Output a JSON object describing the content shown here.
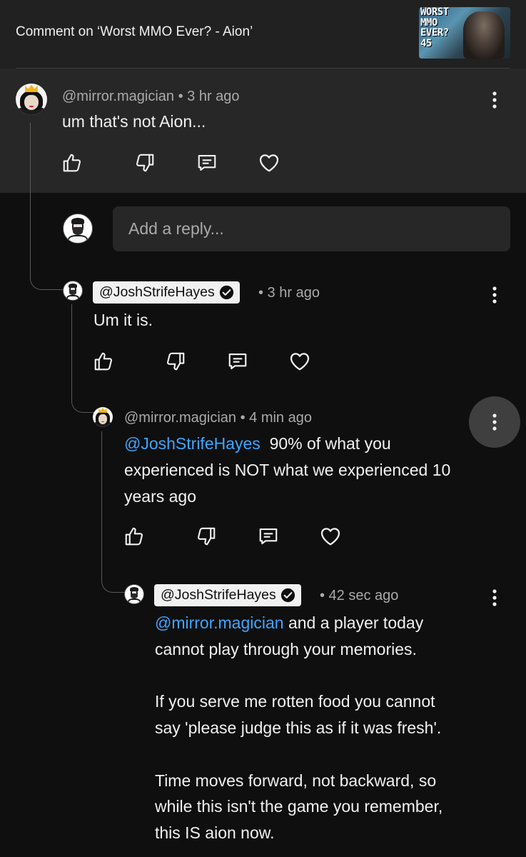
{
  "header": {
    "title": "Comment on ‘Worst MMO Ever? - Aion’",
    "thumbnail_text": "WORST\nMMO\nEVER?\n45"
  },
  "reply_box": {
    "placeholder": "Add a reply..."
  },
  "comments": [
    {
      "author": "@mirror.magician",
      "time": "• 3 hr ago",
      "lines": [
        "um that's not Aion..."
      ]
    },
    {
      "author": "@JoshStrifeHayes",
      "time": "• 3 hr ago",
      "lines": [
        "Um it is."
      ]
    },
    {
      "author": "@mirror.magician",
      "time": "• 4 min ago",
      "mention": "@JoshStrifeHayes",
      "lines": [
        "90% of what you",
        "experienced is NOT what we experienced 10",
        "years ago"
      ]
    },
    {
      "author": "@JoshStrifeHayes",
      "time": "• 42 sec ago",
      "mention": "@mirror.magician",
      "lines": [
        "and a player today",
        "cannot play through your memories.",
        "",
        "If you serve me rotten food you cannot",
        "say 'please judge this as if it was fresh'.",
        "",
        "Time moves forward, not backward, so",
        "while this isn't the game you remember,",
        "this IS aion now."
      ]
    }
  ],
  "icons": {
    "like": "thumbs-up-icon",
    "dislike": "thumbs-down-icon",
    "reply": "reply-comment-icon",
    "heart": "heart-icon",
    "more": "more-vert-icon",
    "verified": "verified-check-icon"
  },
  "colors": {
    "background": "#0f0f0f",
    "highlight": "#272727",
    "mention": "#3ea6ff",
    "meta": "#aaaaaa"
  }
}
